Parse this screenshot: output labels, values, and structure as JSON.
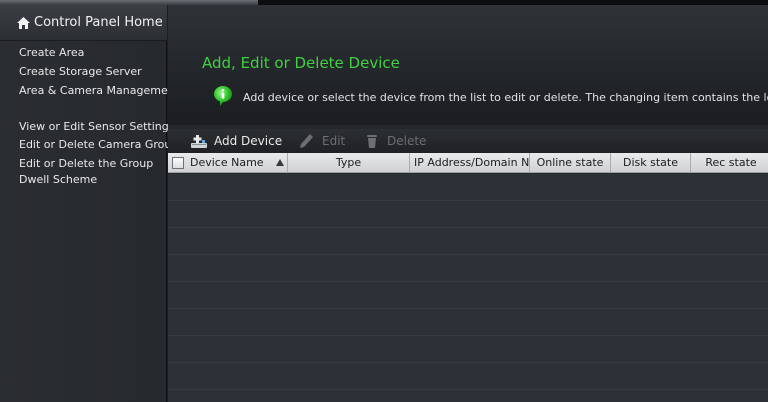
{
  "sidebar": {
    "home_label": "Control Panel Home",
    "items": [
      {
        "label": "Create Area"
      },
      {
        "label": "Create Storage Server"
      },
      {
        "label": "Area & Camera Management"
      },
      {
        "label": "View or Edit Sensor Settings"
      },
      {
        "label": "Edit or Delete Camera Group"
      },
      {
        "label": "Edit or Delete the Group"
      },
      {
        "label": "Dwell Scheme"
      }
    ]
  },
  "header": {
    "title": "Add, Edit or Delete Device",
    "info": "Add device or select the device from the list to edit or delete. The changing item contains the local c"
  },
  "toolbar": {
    "add_label": "Add Device",
    "edit_label": "Edit",
    "delete_label": "Delete"
  },
  "table": {
    "columns": [
      {
        "label": "Device Name"
      },
      {
        "label": "Type"
      },
      {
        "label": "IP Address/Domain Na"
      },
      {
        "label": "Online state"
      },
      {
        "label": "Disk state"
      },
      {
        "label": "Rec state"
      }
    ],
    "rows": []
  },
  "colors": {
    "title_green": "#3fd13f",
    "sidebar_bg": "#2a2d31",
    "header_bg": "#e9eaec"
  },
  "icons": [
    "home-icon",
    "info-icon",
    "add-device-icon",
    "edit-pencil-icon",
    "delete-trash-icon",
    "sort-ascending-icon"
  ]
}
